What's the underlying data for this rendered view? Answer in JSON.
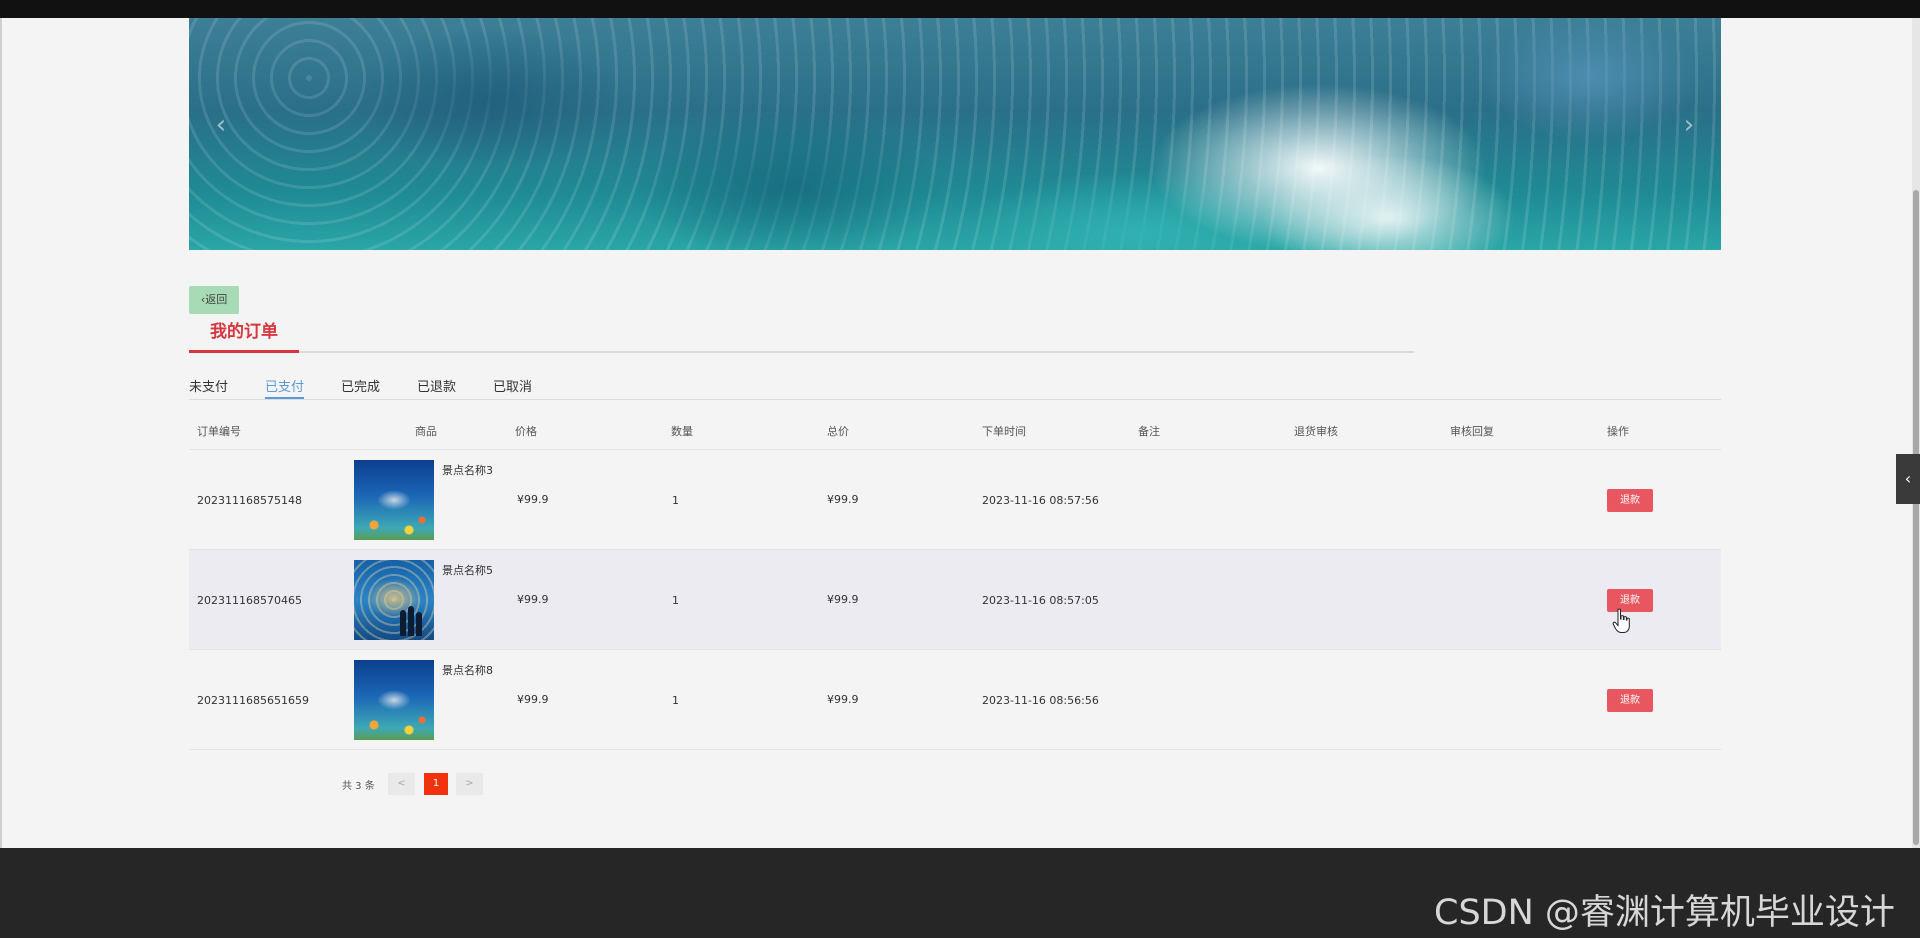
{
  "banner": {
    "prev_arrow": "‹",
    "next_arrow": "›"
  },
  "back_button": {
    "label": "返回",
    "icon": "arrow-left-icon"
  },
  "page_title": "我的订单",
  "tabs": [
    {
      "label": "未支付",
      "active": false
    },
    {
      "label": "已支付",
      "active": true
    },
    {
      "label": "已完成",
      "active": false
    },
    {
      "label": "已退款",
      "active": false
    },
    {
      "label": "已取消",
      "active": false
    }
  ],
  "table": {
    "headers": [
      "订单编号",
      "商品",
      "价格",
      "数量",
      "总价",
      "下单时间",
      "备注",
      "退货审核",
      "审核回复",
      "操作"
    ],
    "rows": [
      {
        "order_no": "202311168575148",
        "product_name": "景点名称3",
        "price": "¥99.9",
        "quantity": "1",
        "total": "¥99.9",
        "order_time": "2023-11-16 08:57:56",
        "remark": "",
        "return_review": "",
        "review_reply": "",
        "action": "退款",
        "thumb": "dolphin"
      },
      {
        "order_no": "202311168570465",
        "product_name": "景点名称5",
        "price": "¥99.9",
        "quantity": "1",
        "total": "¥99.9",
        "order_time": "2023-11-16 08:57:05",
        "remark": "",
        "return_review": "",
        "review_reply": "",
        "action": "退款",
        "thumb": "aquarium"
      },
      {
        "order_no": "2023111685651659",
        "product_name": "景点名称8",
        "price": "¥99.9",
        "quantity": "1",
        "total": "¥99.9",
        "order_time": "2023-11-16 08:56:56",
        "remark": "",
        "return_review": "",
        "review_reply": "",
        "action": "退款",
        "thumb": "dolphin"
      }
    ]
  },
  "pagination": {
    "total_text": "共 3 条",
    "prev": "<",
    "current_page": "1",
    "next": ">"
  },
  "side_toggle": {
    "label": "‹",
    "icon": "chevron-left-icon"
  },
  "watermark": "CSDN @睿渊计算机毕业设计",
  "colors": {
    "accent_red": "#d8363f",
    "refund_button": "#e8575f",
    "tab_active": "#5b9bd5",
    "back_button": "#a6dbb6",
    "pager_active": "#f0320e",
    "footer": "#262626"
  }
}
